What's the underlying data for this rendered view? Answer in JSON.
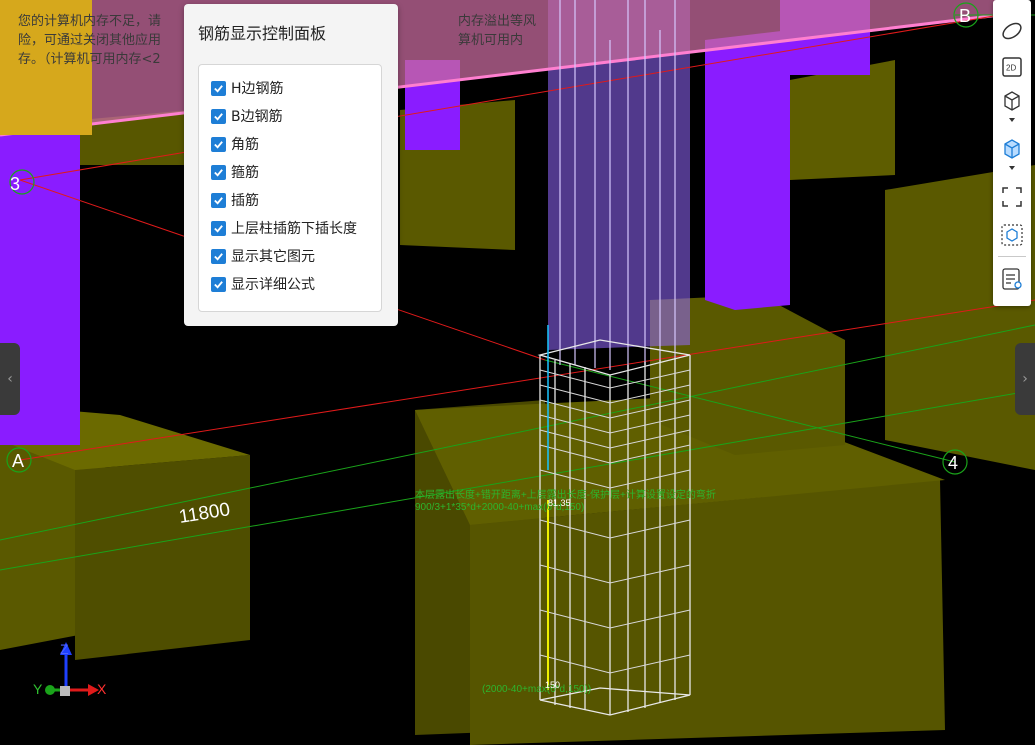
{
  "warning": {
    "text": "您的计算机内存不足，请\n险，可通过关闭其他应用\n存。（计算机可用内存<2"
  },
  "warning_right": {
    "text": "内存溢出等风\n算机可用内"
  },
  "panel": {
    "title": "钢筋显示控制面板",
    "options": [
      {
        "label": "H边钢筋",
        "checked": true
      },
      {
        "label": "B边钢筋",
        "checked": true
      },
      {
        "label": "角筋",
        "checked": true
      },
      {
        "label": "箍筋",
        "checked": true
      },
      {
        "label": "插筋",
        "checked": true
      },
      {
        "label": "上层柱插筋下插长度",
        "checked": true
      },
      {
        "label": "显示其它图元",
        "checked": true
      },
      {
        "label": "显示详细公式",
        "checked": true
      }
    ]
  },
  "axes": {
    "labels": [
      "B",
      "3",
      "A",
      "4"
    ],
    "dimension": "11800"
  },
  "annotations": {
    "formula_line1": "本层露出长度+错开距离+上层露出长度-保护层+计算设置设定的弯折",
    "formula_line2": "900/3+1*35*d+2000-40+max(6*d,150)",
    "value_top": "81.35",
    "formula_bottom": "(2000-40+max(6*d,150))",
    "value_bottom": "150"
  },
  "coord": {
    "z": "Z",
    "y": "Y",
    "x": "X"
  },
  "toolbar": {
    "buttons": [
      {
        "name": "orbit-icon",
        "label": ""
      },
      {
        "name": "2d-view-icon",
        "label": "2D"
      },
      {
        "name": "cube-wire-icon",
        "label": ""
      },
      {
        "name": "cube-solid-icon",
        "label": ""
      },
      {
        "name": "fit-view-icon",
        "label": ""
      },
      {
        "name": "section-box-icon",
        "label": ""
      },
      {
        "name": "display-settings-icon",
        "label": ""
      }
    ]
  },
  "colors": {
    "accent": "#1e7ed6",
    "grid_red": "#e01a1a",
    "grid_green": "#1aa31a",
    "column_purple": "#8a1cff",
    "footing_olive": "#5c5a00"
  }
}
